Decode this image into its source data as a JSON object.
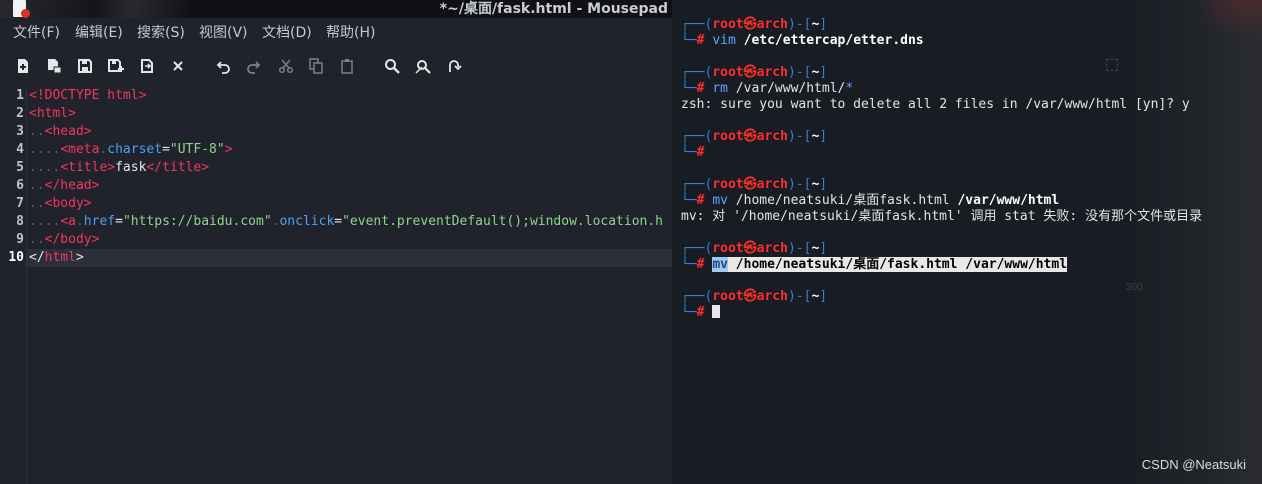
{
  "editor": {
    "window_title": "*~/桌面/fask.html - Mousepad",
    "menu": [
      {
        "label": "文件(F)"
      },
      {
        "label": "编辑(E)"
      },
      {
        "label": "搜索(S)"
      },
      {
        "label": "视图(V)"
      },
      {
        "label": "文档(D)"
      },
      {
        "label": "帮助(H)"
      }
    ],
    "toolbar_icons": [
      "new-file-icon",
      "new-window-icon",
      "save-icon",
      "save-as-icon",
      "reload-icon",
      "close-icon",
      "undo-icon",
      "redo-icon",
      "cut-icon",
      "copy-icon",
      "paste-icon",
      "find-icon",
      "find-replace-icon",
      "goto-icon"
    ],
    "line_numbers": [
      "1",
      "2",
      "3",
      "4",
      "5",
      "6",
      "7",
      "8",
      "9",
      "10"
    ],
    "active_line": "10",
    "code": {
      "l1": "<!DOCTYPE html>",
      "l2": "<html>",
      "l3_ind": "..",
      "l3": "<head>",
      "l4_ind": "....",
      "l4_tag": "<meta",
      "l4_dot": ".",
      "l4_attr": "charset",
      "l4_eq": "=",
      "l4_val": "\"UTF-8\"",
      "l4_close": ">",
      "l5_ind": "....",
      "l5_open": "<title>",
      "l5_text": "fask",
      "l5_close": "</title>",
      "l6_ind": "..",
      "l6": "</head>",
      "l7_ind": "..",
      "l7": "<body>",
      "l8_ind": "....",
      "l8_tag": "<a",
      "l8_dot": ".",
      "l8_attr1": "href",
      "l8_eq1": "=",
      "l8_val1": "\"https://baidu.com\"",
      "l8_dot2": ".",
      "l8_attr2": "onclick",
      "l8_eq2": "=",
      "l8_val2": "\"event.preventDefault();window.location.h",
      "l9_ind": "..",
      "l9": "</body>",
      "l10_open": "</",
      "l10_tag": "html",
      "l10_close": ">"
    },
    "colors": {
      "tag": "#f3365e",
      "attr": "#4f9ff2",
      "value": "#8bd68b"
    }
  },
  "terminal": {
    "prompt_user": "root",
    "prompt_at": "㉿",
    "prompt_host": "arch",
    "prompt_dir": "~",
    "prompt_char": "#",
    "blocks": [
      {
        "cmd": "vim",
        "args": " /etc/ettercap/etter.dns"
      },
      {
        "cmd": "rm",
        "args": " /var/www/html/",
        "glob": "*",
        "output": "zsh: sure you want to delete all 2 files in /var/www/html [yn]? y"
      },
      {
        "cmd": "",
        "args": ""
      },
      {
        "cmd": "mv",
        "args_a": " /home/neatsuki/桌面fask.html ",
        "args_b": "/var/www/html",
        "output_a": "mv: 对 '/home/neatsuki/桌面fask.html' 调用 stat 失败: 没有那个文件或目录"
      },
      {
        "cmd": "mv",
        "args": " /home/neatsuki/桌面/fask.html /var/www/html"
      },
      {
        "cmd": "",
        "args": ""
      }
    ],
    "watermark": "CSDN @Neatsuki",
    "faint_text": "300"
  }
}
